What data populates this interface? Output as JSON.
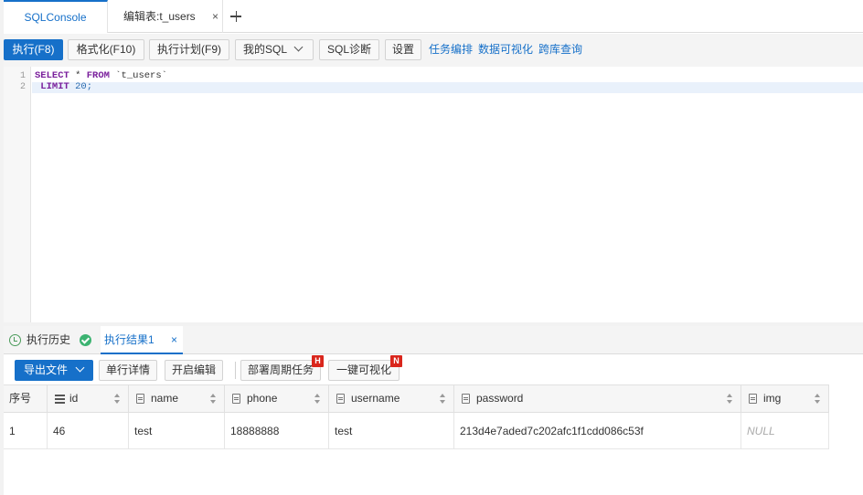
{
  "tabs": {
    "sql_console": "SQLConsole",
    "edit_table": "编辑表:t_users",
    "close": "×"
  },
  "toolbar": {
    "execute": "执行(F8)",
    "format": "格式化(F10)",
    "plan": "执行计划(F9)",
    "my_sql": "我的SQL",
    "diagnose": "SQL诊断",
    "settings": "设置",
    "task_orchestration": "任务编排",
    "data_visualization": "数据可视化",
    "cross_db_query": "跨库查询"
  },
  "editor": {
    "line_numbers": [
      "1",
      "2"
    ],
    "line1": {
      "select": "SELECT",
      "star": " * ",
      "from": "FROM",
      "table": " `t_users`"
    },
    "line2": {
      "limit": " LIMIT",
      "value": " 20;"
    }
  },
  "result_tabs": {
    "history": "执行历史",
    "result": "执行结果1",
    "close": "×"
  },
  "result_toolbar": {
    "export": "导出文件",
    "row_detail": "单行详情",
    "enable_edit": "开启编辑",
    "schedule_task": "部署周期任务",
    "schedule_badge": "H",
    "one_click_viz": "一键可视化",
    "viz_badge": "N"
  },
  "table": {
    "columns": [
      "序号",
      "id",
      "name",
      "phone",
      "username",
      "password",
      "img"
    ],
    "rows": [
      [
        "1",
        "46",
        "test",
        "18888888",
        "test",
        "213d4e7aded7c202afc1f1cdd086c53f",
        "NULL"
      ]
    ]
  },
  "colors": {
    "accent": "#1670c9",
    "badge": "#d9261c",
    "success": "#3cb371"
  }
}
